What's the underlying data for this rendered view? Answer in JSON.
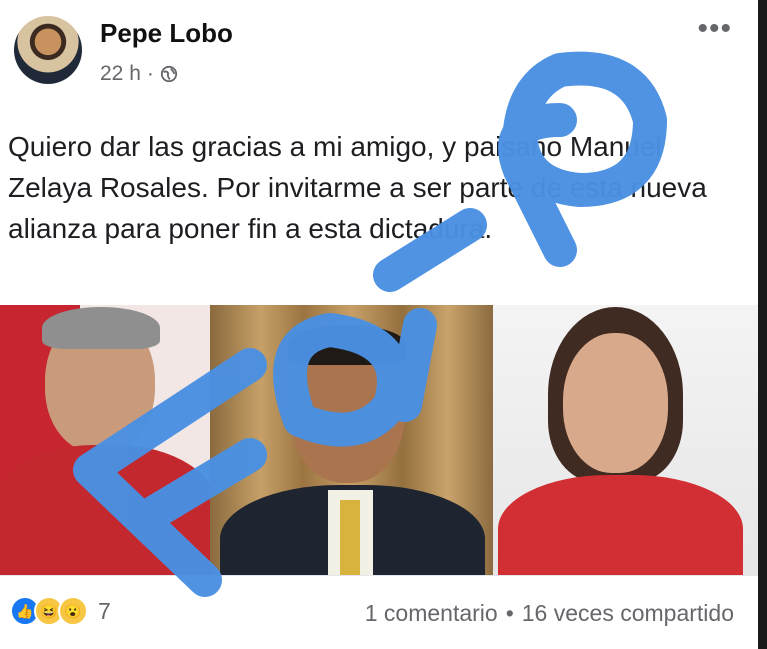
{
  "post": {
    "author": "Pepe Lobo",
    "time": "22 h",
    "separator": "·",
    "audience_icon": "globe-icon",
    "more_icon": "more-options-icon",
    "text": "Quiero dar las gracias a mi amigo, y paisano Manuel Zelaya Rosales. Por invitarme a ser parte de esta nueva alianza para poner fin a esta dictadura."
  },
  "photos": [
    "man-in-red-shirt",
    "man-in-suit",
    "woman-in-red-blouse"
  ],
  "footer": {
    "reaction_icons": [
      "like-icon",
      "haha-icon",
      "wow-icon"
    ],
    "reaction_count": "7",
    "comments": "1 comentario",
    "dot": "•",
    "shares": "16 veces compartido"
  },
  "overlay": {
    "stamp_text": "Falso",
    "color": "#4a90e2"
  }
}
